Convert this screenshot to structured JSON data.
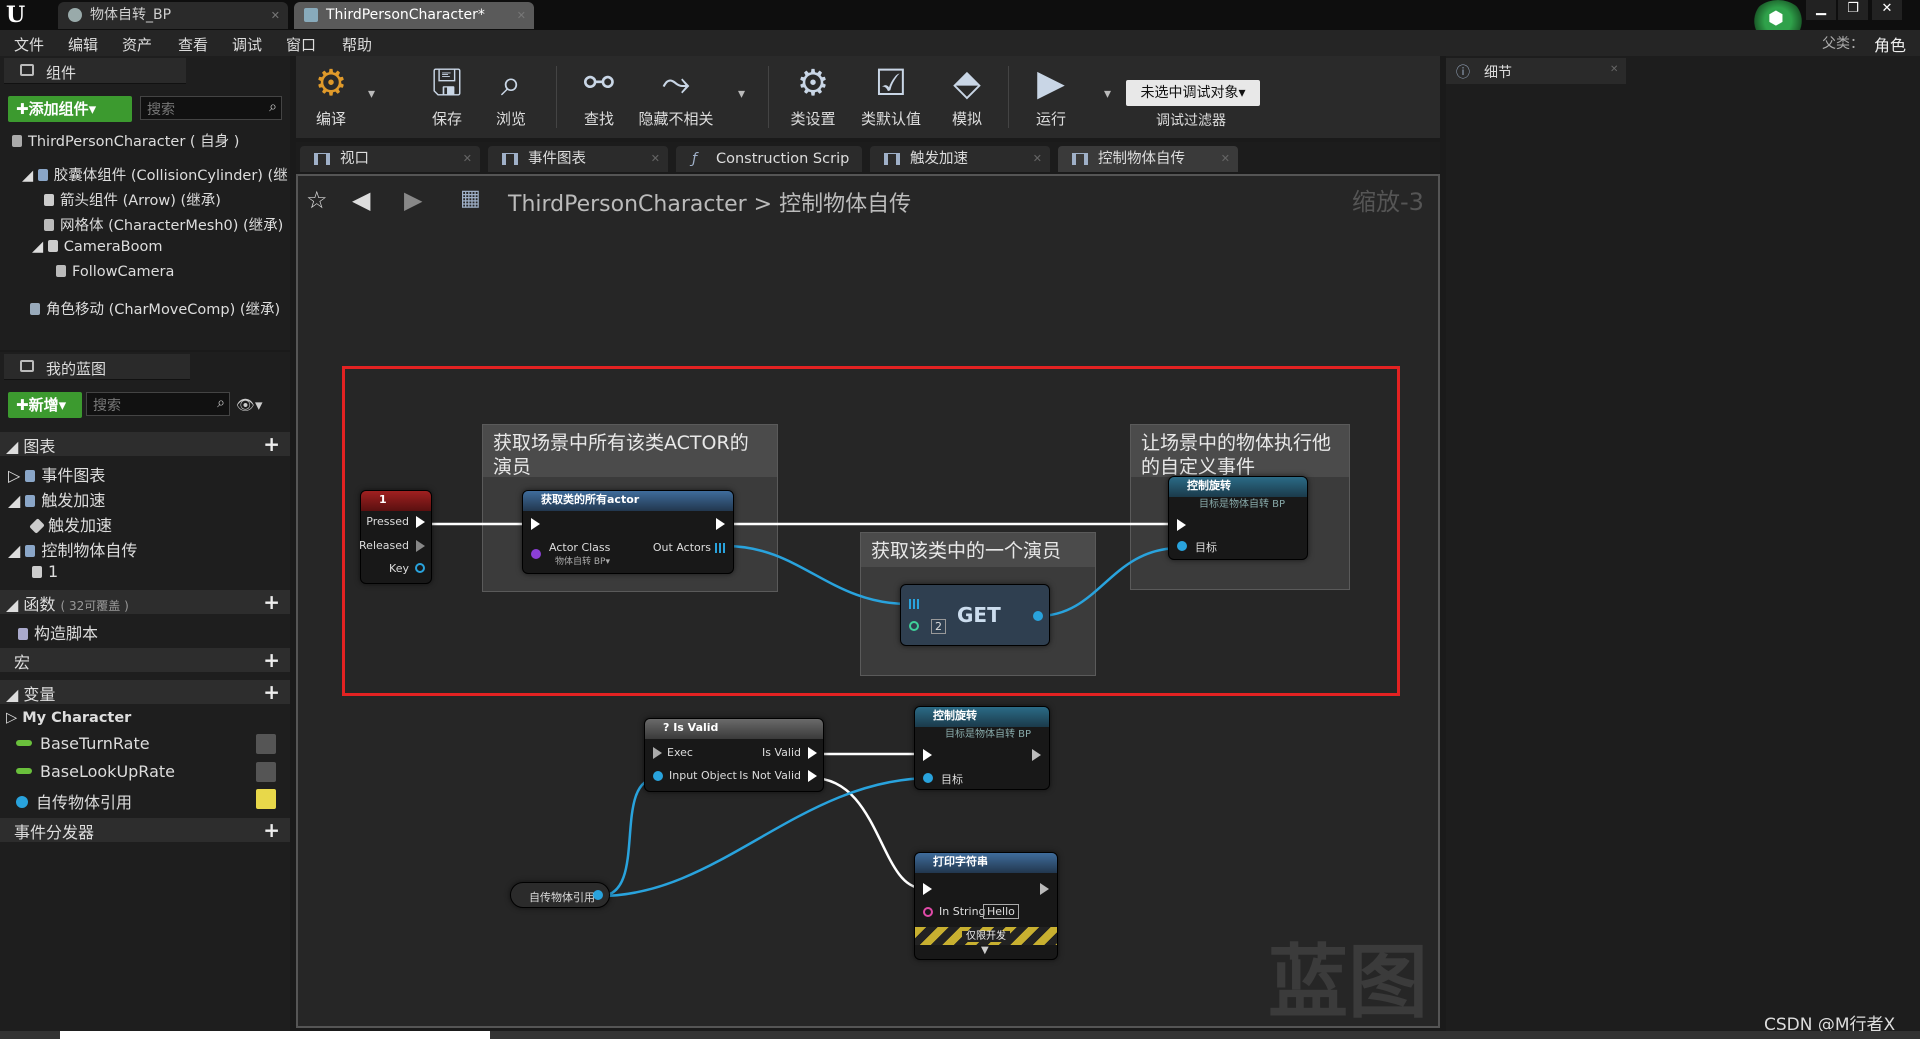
{
  "window": {
    "tab1": "物体自转_BP",
    "tab2": "ThirdPersonCharacter*"
  },
  "menu": [
    "文件",
    "编辑",
    "资产",
    "查看",
    "调试",
    "窗口",
    "帮助"
  ],
  "parent": {
    "label": "父类：",
    "value": "角色"
  },
  "components": {
    "tab": "组件",
    "add_button": "✚添加组件▾",
    "search_placeholder": "搜索",
    "root": "ThirdPersonCharacter ( 自身 )",
    "items": [
      "胶囊体组件 (CollisionCylinder) (继",
      "箭头组件 (Arrow) (继承)",
      "网格体 (CharacterMesh0) (继承)",
      "CameraBoom",
      "FollowCamera",
      "角色移动 (CharMoveComp) (继承)"
    ]
  },
  "my_blueprint": {
    "tab": "我的蓝图",
    "new_button": "✚新增▾",
    "search_placeholder": "搜索",
    "graphs_header": "图表",
    "graphs": [
      "事件图表",
      "触发加速",
      "触发加速",
      "控制物体自传",
      "1"
    ],
    "functions_header": "函数",
    "functions_note": "( 32可覆盖 )",
    "functions": [
      "构造脚本"
    ],
    "macros_header": "宏",
    "variables_header": "变量",
    "var_category": "My Character",
    "variables": [
      "BaseTurnRate",
      "BaseLookUpRate",
      "自传物体引用"
    ],
    "dispatchers_header": "事件分发器"
  },
  "toolbar": {
    "buttons": [
      "编译",
      "保存",
      "浏览",
      "查找",
      "隐藏不相关",
      "类设置",
      "类默认值",
      "模拟",
      "运行"
    ],
    "debug_select": "未选中调试对象▾",
    "debug_filter": "调试过滤器"
  },
  "doc_tabs": [
    "视口",
    "事件图表",
    "Construction Scrip",
    "触发加速",
    "控制物体自传"
  ],
  "breadcrumb": {
    "root": "ThirdPersonCharacter",
    "sep": ">",
    "current": "控制物体自传"
  },
  "zoom": "缩放-3",
  "watermark": "蓝图",
  "details_tab": "细节",
  "comments": {
    "c1": "获取场景中所有该类ACTOR的演员",
    "c2": "获取该类中的一个演员",
    "c3": "让场景中的物体执行他的自定义事件"
  },
  "nodes": {
    "key1": {
      "title": "1",
      "pins": [
        "Pressed",
        "Released",
        "Key"
      ]
    },
    "getall": {
      "title": "获取类的所有actor",
      "actor_class": "Actor Class",
      "class_value": "物体自转 BP▾",
      "out": "Out Actors"
    },
    "get": {
      "title": "GET",
      "index": "2"
    },
    "rotate1": {
      "title": "控制旋转",
      "sub": "目标是物体自转 BP",
      "target": "目标"
    },
    "isvalid": {
      "title": "? Is Valid",
      "exec": "Exec",
      "input": "Input Object",
      "valid": "Is Valid",
      "notvalid": "Is Not Valid"
    },
    "rotate2": {
      "title": "控制旋转",
      "sub": "目标是物体自转 BP",
      "target": "目标"
    },
    "print": {
      "title": "打印字符串",
      "in_string": "In String",
      "value": "Hello",
      "dev": "仅限开发"
    },
    "varref": {
      "title": "自传物体引用"
    }
  },
  "credit": "CSDN @M行者X",
  "colors": {
    "accent_red": "#e32222",
    "pin_blue": "#29a3dd",
    "green_button": "#3c9a2f"
  }
}
